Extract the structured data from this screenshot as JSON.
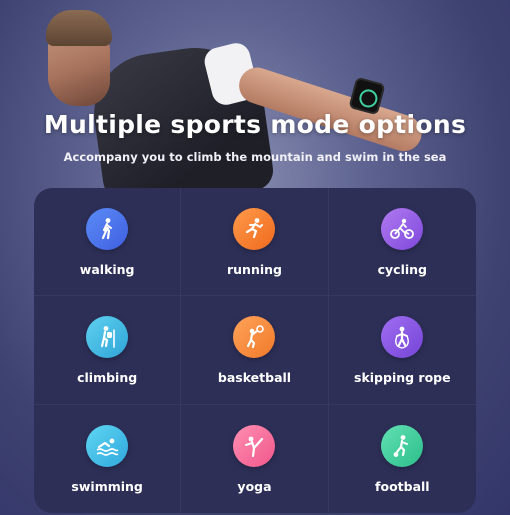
{
  "header": {
    "title": "Multiple sports mode options",
    "subtitle": "Accompany you to climb the mountain and swim in the sea"
  },
  "sports": [
    {
      "label": "walking",
      "icon": "walking-icon",
      "color_from": "#5b8cf7",
      "color_to": "#3f5fe0"
    },
    {
      "label": "running",
      "icon": "running-icon",
      "color_from": "#ff9a4a",
      "color_to": "#f06a1e"
    },
    {
      "label": "cycling",
      "icon": "cycling-icon",
      "color_from": "#b07af0",
      "color_to": "#7e48dc"
    },
    {
      "label": "climbing",
      "icon": "climbing-icon",
      "color_from": "#5fd0ef",
      "color_to": "#2fa5d8"
    },
    {
      "label": "basketball",
      "icon": "basketball-icon",
      "color_from": "#ffa25a",
      "color_to": "#f07a2a"
    },
    {
      "label": "skipping rope",
      "icon": "skipping-rope-icon",
      "color_from": "#a06ef2",
      "color_to": "#7444d6"
    },
    {
      "label": "swimming",
      "icon": "swimming-icon",
      "color_from": "#5fd6f2",
      "color_to": "#2fa8dd"
    },
    {
      "label": "yoga",
      "icon": "yoga-icon",
      "color_from": "#ff8fb3",
      "color_to": "#f0578a"
    },
    {
      "label": "football",
      "icon": "football-icon",
      "color_from": "#62e0b4",
      "color_to": "#2cbf8a"
    }
  ]
}
